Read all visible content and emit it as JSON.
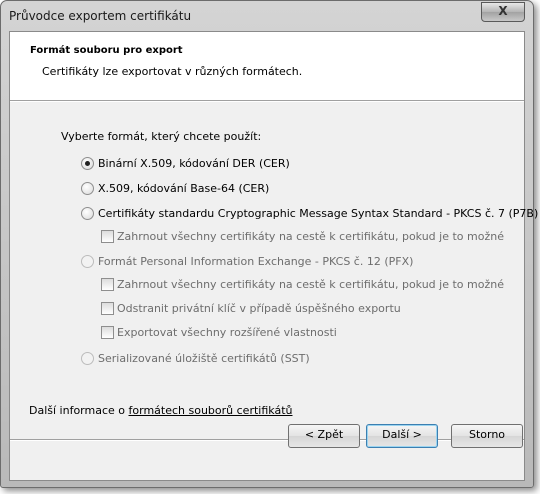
{
  "window": {
    "title": "Průvodce exportem certifikátu",
    "close_glyph": "X"
  },
  "header": {
    "heading": "Formát souboru pro export",
    "subheading": "Certifikáty lze exportovat v různých formátech."
  },
  "prompt": "Vyberte formát, který chcete použít:",
  "options": [
    {
      "label": "Binární X.509, kódování DER (CER)",
      "selected": true,
      "enabled": true
    },
    {
      "label": "X.509, kódování Base-64 (CER)",
      "selected": false,
      "enabled": true
    },
    {
      "label": "Certifikáty standardu Cryptographic Message Syntax Standard - PKCS č. 7 (P7B)",
      "selected": false,
      "enabled": true
    },
    {
      "label": "Formát Personal Information Exchange - PKCS č. 12 (PFX)",
      "selected": false,
      "enabled": false
    },
    {
      "label": "Serializované úložiště certifikátů (SST)",
      "selected": false,
      "enabled": false
    }
  ],
  "checkboxes": {
    "p7b_include_all": "Zahrnout všechny certifikáty na cestě k certifikátu, pokud je to možné",
    "pfx_include_all": "Zahrnout všechny certifikáty na cestě k certifikátu, pokud je to možné",
    "pfx_delete_key": "Odstranit privátní klíč v případě úspěšného exportu",
    "pfx_export_props": "Exportovat všechny rozšířené vlastnosti"
  },
  "more_info": {
    "prefix": "Další informace o ",
    "link": "formátech souborů certifikátů"
  },
  "buttons": {
    "back": "< Zpět",
    "next": "Další >",
    "cancel": "Storno"
  }
}
